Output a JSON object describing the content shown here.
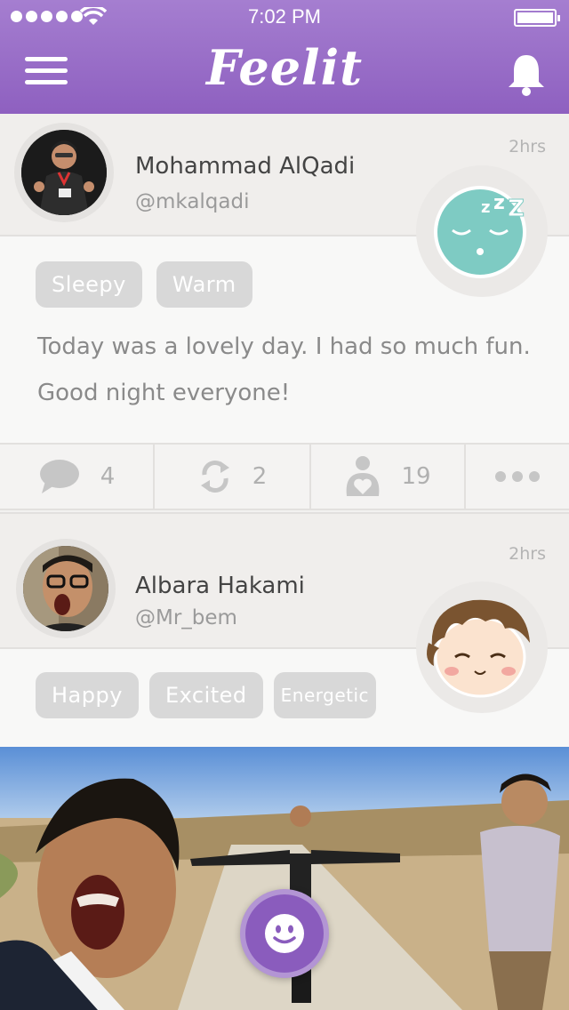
{
  "status_bar": {
    "time": "7:02 PM"
  },
  "header": {
    "logo": "Feelit"
  },
  "colors": {
    "brand": "#9b6dcb",
    "mood_sleepy": "#7ecbc3",
    "tag_bg": "#d8d8d8"
  },
  "posts": [
    {
      "name": "Mohammad AlQadi",
      "handle": "@mkalqadi",
      "time_ago": "2hrs",
      "mood_icon": "sleepy-face-icon",
      "tags": [
        "Sleepy",
        "Warm"
      ],
      "text": "Today was a lovely day. I had so much fun. Good night everyone!",
      "actions": {
        "comments": "4",
        "reposts": "2",
        "feels": "19"
      }
    },
    {
      "name": "Albara Hakami",
      "handle": "@Mr_bem",
      "time_ago": "2hrs",
      "mood_icon": "happy-chibi-face-icon",
      "tags": [
        "Happy",
        "Excited",
        "Energetic"
      ]
    }
  ],
  "fab": {
    "icon": "smiley-face-icon"
  }
}
